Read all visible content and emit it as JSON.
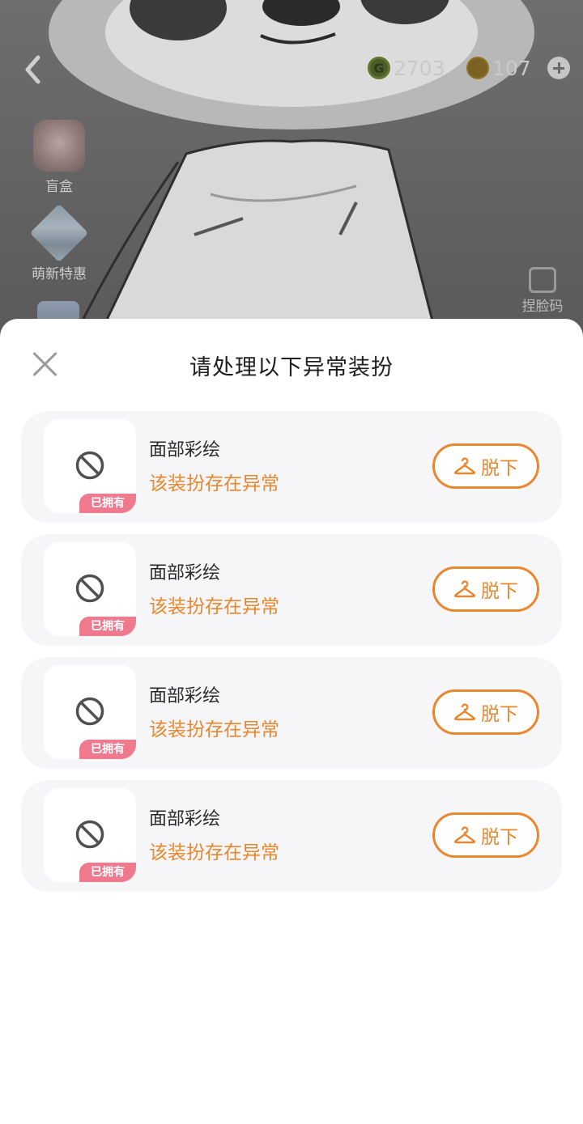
{
  "header": {
    "currency_g": {
      "icon": "g-coin-icon",
      "value": "2703"
    },
    "currency_coin": {
      "icon": "gold-coin-icon",
      "value": "107"
    }
  },
  "side_menu": [
    {
      "label": "盲盒",
      "icon": "gift-box-icon"
    },
    {
      "label": "萌新特惠",
      "icon": "newbie-deal-icon"
    }
  ],
  "face_button": {
    "label": "捏脸码",
    "icon": "edit-face-icon"
  },
  "dialog": {
    "title": "请处理以下异常装扮",
    "items": [
      {
        "name": "面部彩绘",
        "status": "该装扮存在异常",
        "badge": "已拥有",
        "button": "脱下"
      },
      {
        "name": "面部彩绘",
        "status": "该装扮存在异常",
        "badge": "已拥有",
        "button": "脱下"
      },
      {
        "name": "面部彩绘",
        "status": "该装扮存在异常",
        "badge": "已拥有",
        "button": "脱下"
      },
      {
        "name": "面部彩绘",
        "status": "该装扮存在异常",
        "badge": "已拥有",
        "button": "脱下"
      }
    ]
  },
  "colors": {
    "accent": "#e8872d",
    "badge": "#f07a8d",
    "card_bg": "#f6f6f8",
    "overlay": "#5c5c5c"
  }
}
